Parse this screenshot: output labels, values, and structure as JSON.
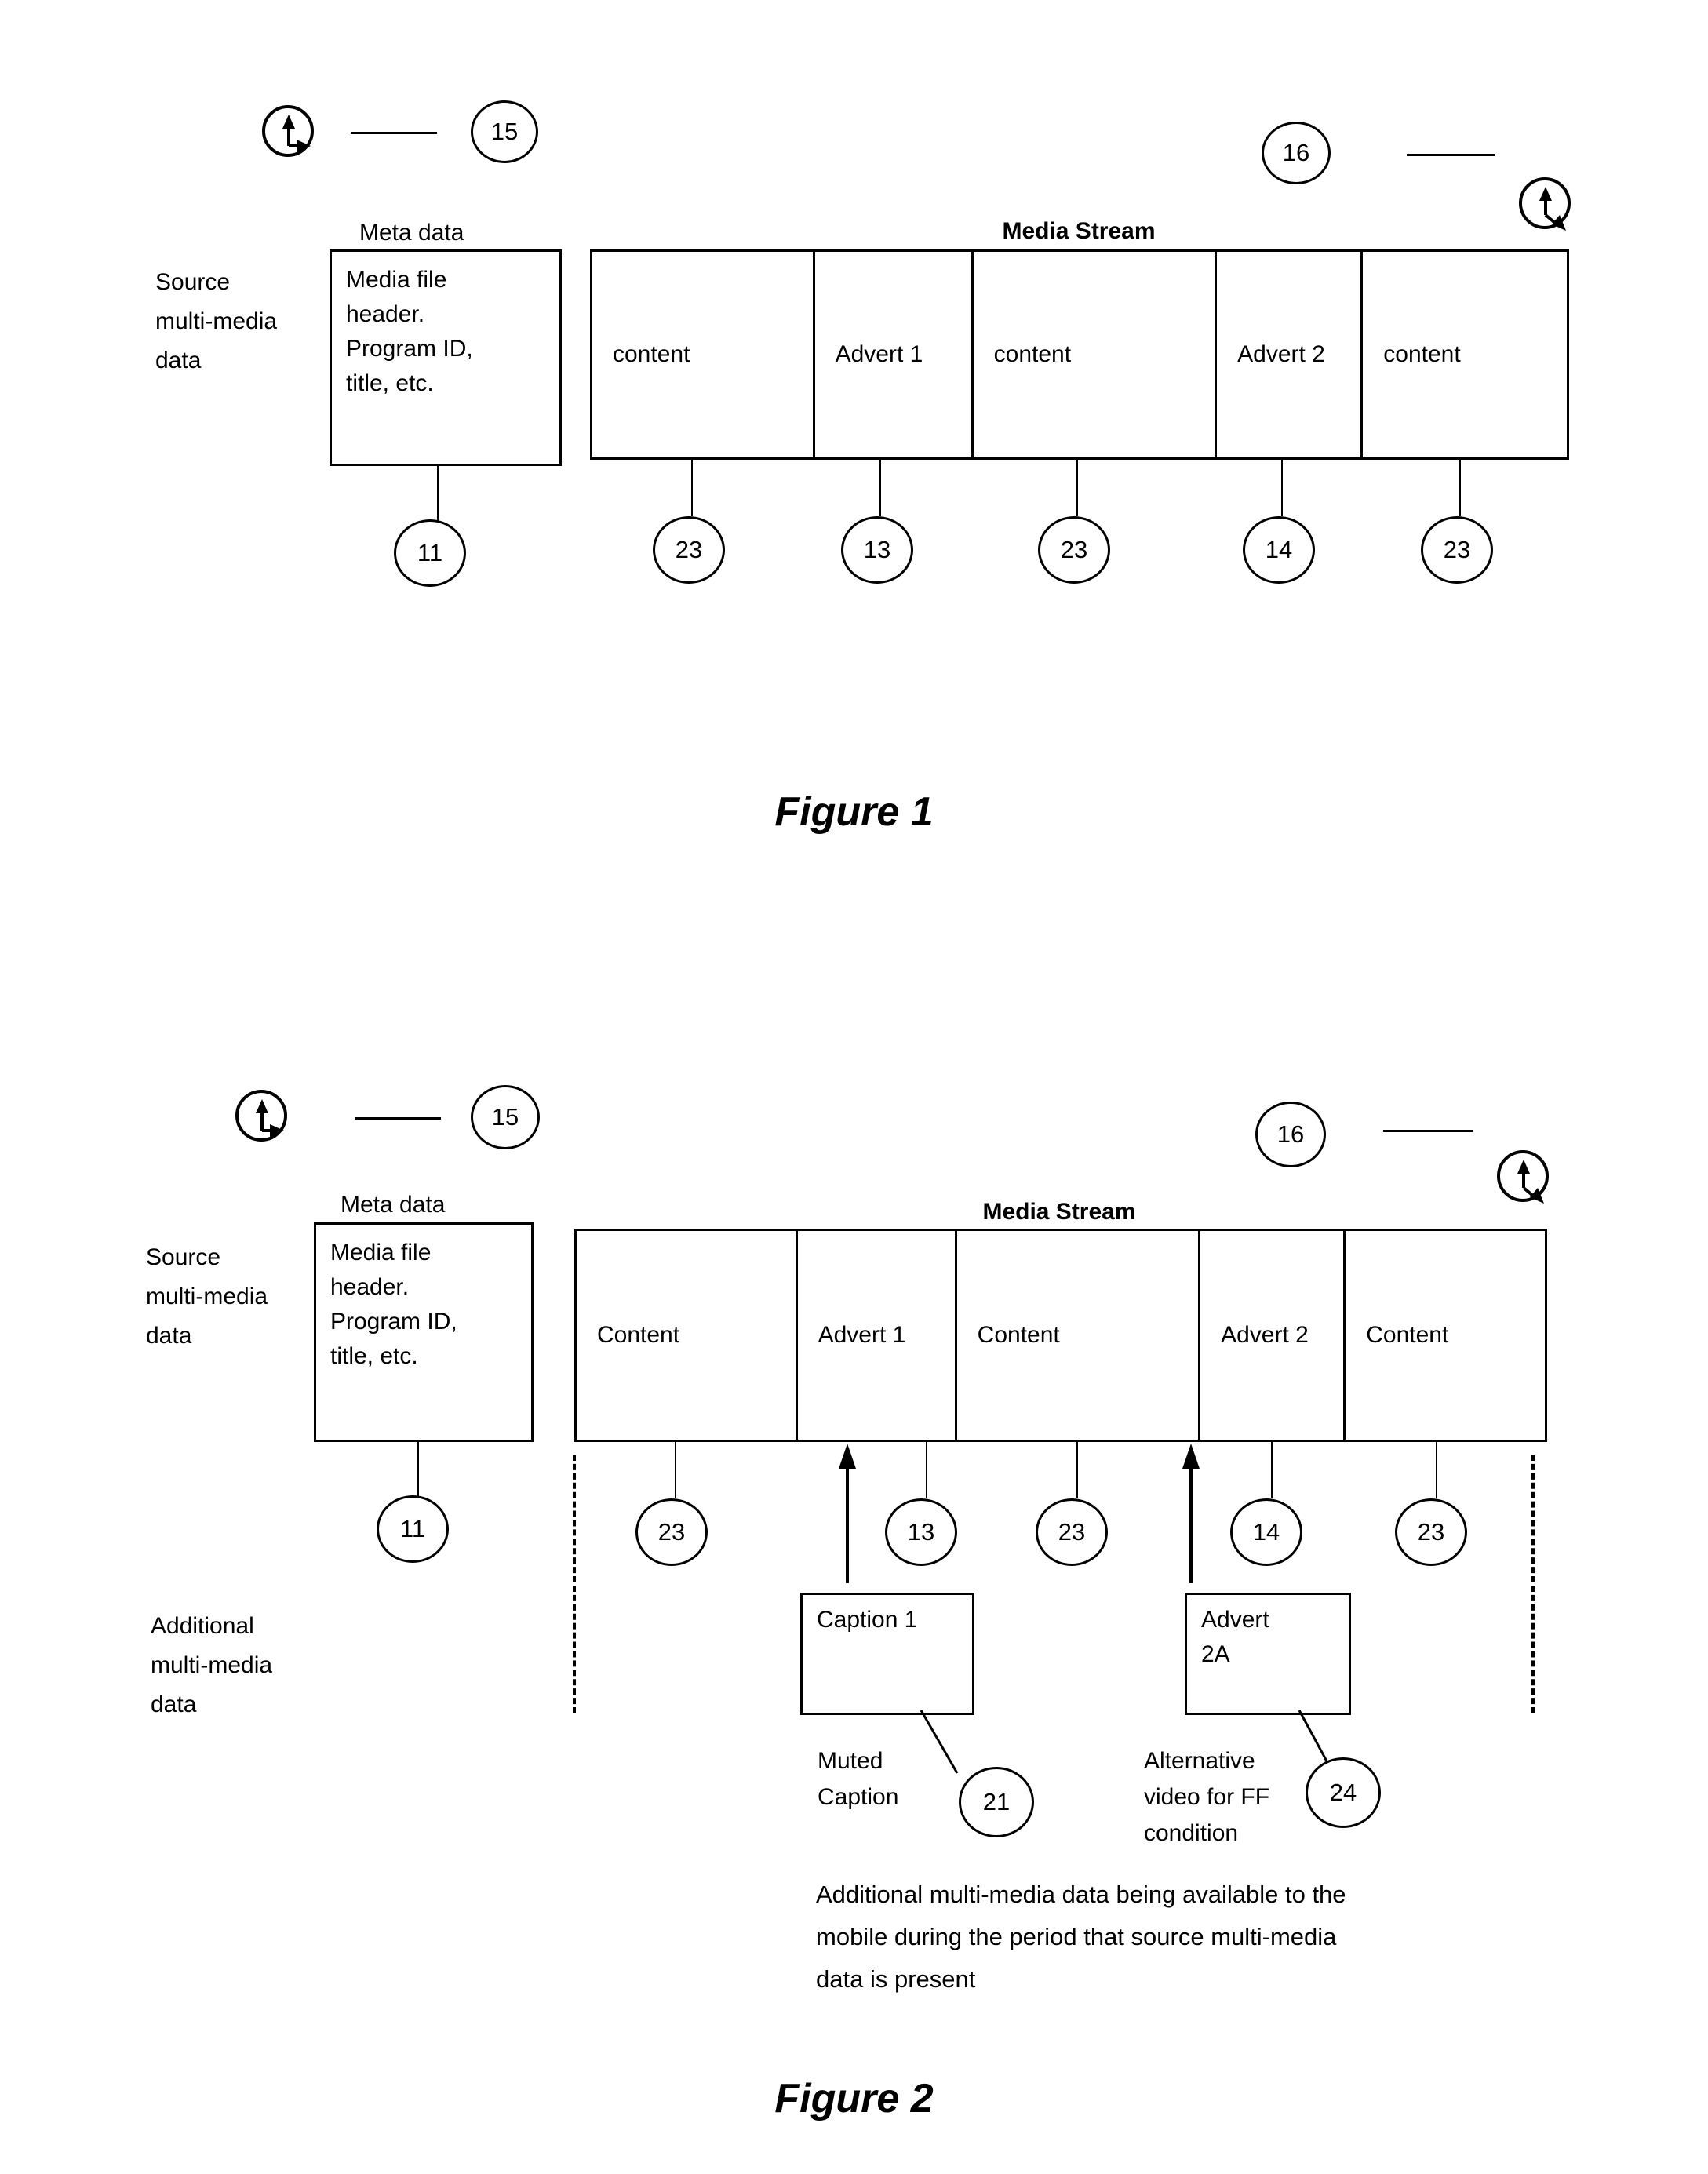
{
  "figure1": {
    "caption": "Figure 1",
    "markers": {
      "left_icon": "bent-arrow-icon",
      "left_ref": "15",
      "right_ref": "16",
      "right_icon": "bent-arrow-icon"
    },
    "side_label": "Source\nmulti-media\ndata",
    "meta_title": "Meta data",
    "meta_body": "Media file\nheader.\nProgram ID,\ntitle, etc.",
    "meta_ref": "11",
    "stream_title": "Media Stream",
    "segments": [
      {
        "label": "content",
        "ref": "23"
      },
      {
        "label": "Advert 1",
        "ref": "13"
      },
      {
        "label": "content",
        "ref": "23"
      },
      {
        "label": "Advert 2",
        "ref": "14"
      },
      {
        "label": "content",
        "ref": "23"
      }
    ]
  },
  "figure2": {
    "caption": "Figure 2",
    "markers": {
      "left_icon": "bent-arrow-icon",
      "left_ref": "15",
      "right_ref": "16",
      "right_icon": "bent-arrow-icon"
    },
    "side_label": "Source\nmulti-media\ndata",
    "side_label_additional": "Additional\nmulti-media\ndata",
    "meta_title": "Meta data",
    "meta_body": "Media file\nheader.\nProgram ID,\ntitle, etc.",
    "meta_ref": "11",
    "stream_title": "Media Stream",
    "segments": [
      {
        "label": "Content",
        "ref": "23"
      },
      {
        "label": "Advert 1",
        "ref": "13"
      },
      {
        "label": "Content",
        "ref": "23"
      },
      {
        "label": "Advert 2",
        "ref": "14"
      },
      {
        "label": "Content",
        "ref": "23"
      }
    ],
    "additional_items": [
      {
        "box_text": "Caption 1",
        "annotation": "Muted\nCaption",
        "ref": "21"
      },
      {
        "box_text": "Advert\n2A",
        "annotation": "Alternative\nvideo for FF\ncondition",
        "ref": "24"
      }
    ],
    "bottom_note": "Additional multi-media data being available to the\nmobile during the period that source multi-media\ndata is present"
  }
}
